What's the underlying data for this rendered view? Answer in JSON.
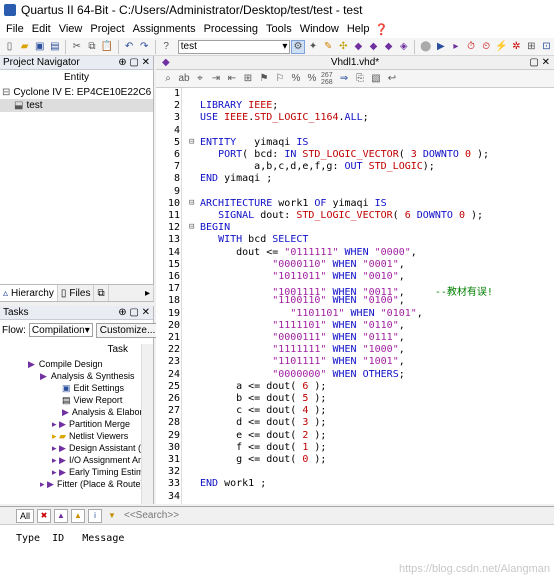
{
  "window": {
    "title": "Quartus II 64-Bit - C:/Users/Administrator/Desktop/test/test - test"
  },
  "menu": [
    "File",
    "Edit",
    "View",
    "Project",
    "Assignments",
    "Processing",
    "Tools",
    "Window",
    "Help"
  ],
  "toolbar": {
    "project_combo": "test"
  },
  "navigator": {
    "title": "Project Navigator",
    "column": "Entity",
    "device": "Cyclone IV E: EP4CE10E22C6",
    "top_entity": "test",
    "tabs": [
      "Hierarchy",
      "Files"
    ]
  },
  "tasks": {
    "title": "Tasks",
    "flow_label": "Flow:",
    "flow_value": "Compilation",
    "customize": "Customize...",
    "column": "Task",
    "items": [
      "Compile Design",
      "Analysis & Synthesis",
      "Edit Settings",
      "View Report",
      "Analysis & Elabora",
      "Partition Merge",
      "Netlist Viewers",
      "Design Assistant (I",
      "I/O Assignment An",
      "Early Timing Estim",
      "Fitter (Place & Route)"
    ]
  },
  "editor": {
    "tab_title": "Vhdl1.vhd*",
    "line_numbers": [
      "1",
      "2",
      "3",
      "4",
      "5",
      "6",
      "7",
      "8",
      "9",
      "10",
      "11",
      "12",
      "13",
      "14",
      "15",
      "16",
      "17",
      "18",
      "19",
      "20",
      "21",
      "22",
      "23",
      "24",
      "25",
      "26",
      "27",
      "28",
      "29",
      "30",
      "31",
      "32",
      "33",
      "34"
    ],
    "lines": [
      "",
      "LIBRARY IEEE;",
      "USE IEEE.STD_LOGIC_1164.ALL;",
      "",
      "ENTITY   yimaqi IS",
      "   PORT( bcd: IN STD_LOGIC_VECTOR( 3 DOWNTO 0 );",
      "         a,b,c,d,e,f,g: OUT STD_LOGIC);",
      "END yimaqi ;",
      "",
      "ARCHITECTURE work1 OF yimaqi IS",
      "   SIGNAL dout: STD_LOGIC_VECTOR( 6 DOWNTO 0 );",
      "BEGIN",
      "   WITH bcd SELECT",
      "      dout <= \"0111111\" WHEN \"0000\",",
      "            \"0000110\" WHEN \"0001\",",
      "            \"1011011\" WHEN \"0010\",",
      "            \"1001111\" WHEN \"0011\",     --教材有误!",
      "            \"1100110\" WHEN \"0100\",",
      "               \"1101101\" WHEN \"0101\",",
      "            \"1111101\" WHEN \"0110\",",
      "            \"0000111\" WHEN \"0111\",",
      "            \"1111111\" WHEN \"1000\",",
      "            \"1101111\" WHEN \"1001\",",
      "            \"0000000\" WHEN OTHERS;",
      "      a <= dout( 6 );",
      "      b <= dout( 5 );",
      "      c <= dout( 4 );",
      "      d <= dout( 3 );",
      "      e <= dout( 2 );",
      "      f <= dout( 1 );",
      "      g <= dout( 0 );",
      "",
      "END work1 ;",
      ""
    ],
    "comment": "--教材有误!"
  },
  "messages": {
    "all_label": "All",
    "search_placeholder": "<<Search>>",
    "headers": "Type  ID   Message"
  },
  "watermark": "https://blog.csdn.net/Alangman"
}
